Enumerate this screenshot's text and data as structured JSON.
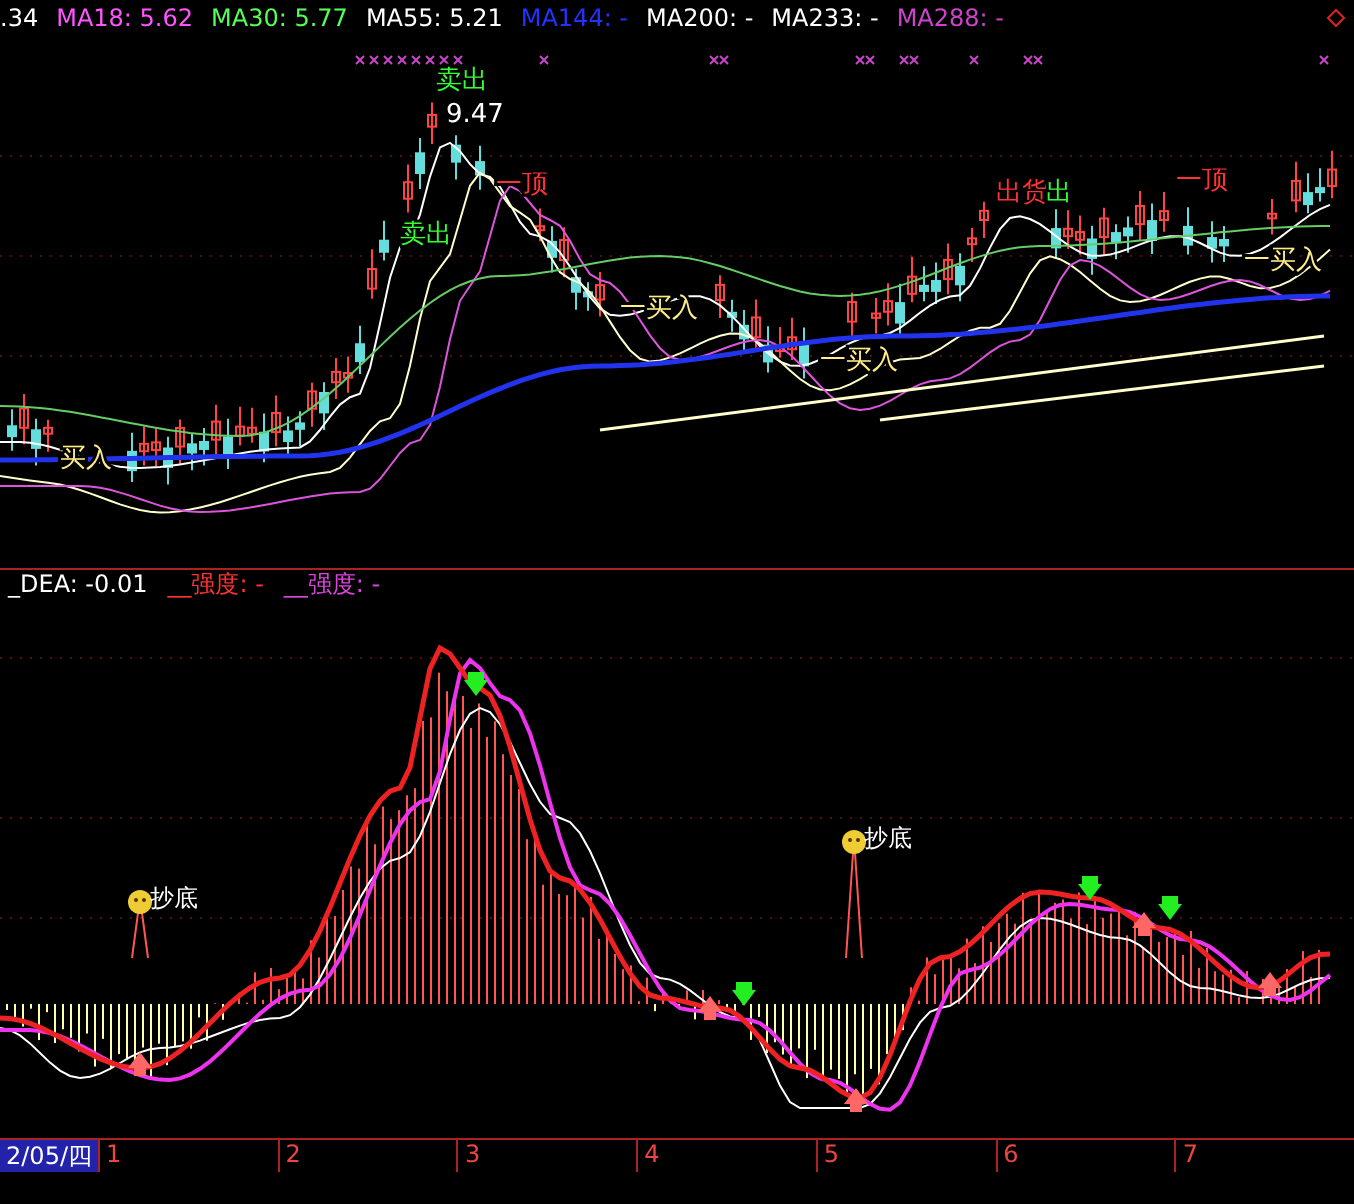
{
  "price_header": {
    "indicators": [
      {
        "text": ".34",
        "color": "#ffffff"
      },
      {
        "text": "MA18: 5.62",
        "color": "#ff55ff"
      },
      {
        "text": "MA30: 5.77",
        "color": "#55ff55"
      },
      {
        "text": "MA55: 5.21",
        "color": "#ffffff"
      },
      {
        "text": "MA144: -",
        "color": "#2233ff"
      },
      {
        "text": "MA200: -",
        "color": "#ffffff"
      },
      {
        "text": "MA233: -",
        "color": "#ffffff"
      },
      {
        "text": "MA288: -",
        "color": "#cc44cc"
      }
    ]
  },
  "price_chart": {
    "annotations": [
      {
        "text": "卖出",
        "kind": "sell"
      },
      {
        "text": "9.47",
        "kind": "price"
      },
      {
        "text": "卖出",
        "kind": "sell"
      },
      {
        "text": "一顶",
        "kind": "top"
      },
      {
        "text": "一买入",
        "kind": "buy"
      },
      {
        "text": "买入",
        "kind": "buy"
      },
      {
        "text": "一买入",
        "kind": "buy"
      },
      {
        "text": "出货",
        "kind": "top"
      },
      {
        "text": "出",
        "kind": "sell"
      },
      {
        "text": "一顶",
        "kind": "top"
      },
      {
        "text": "一买入",
        "kind": "buy"
      }
    ]
  },
  "indicator_header": {
    "items": [
      {
        "text": "_DEA: -0.01",
        "color": "#ffffff"
      },
      {
        "text": "__强度: -",
        "color": "#ff3333"
      },
      {
        "text": "__强度: -",
        "color": "#dd44dd"
      }
    ]
  },
  "indicator_chart": {
    "signals": [
      {
        "text": "抄底"
      },
      {
        "text": "抄底"
      }
    ]
  },
  "time_axis": {
    "date": "2/05/四",
    "labels": [
      "1",
      "2",
      "3",
      "4",
      "5",
      "6",
      "7"
    ]
  }
}
